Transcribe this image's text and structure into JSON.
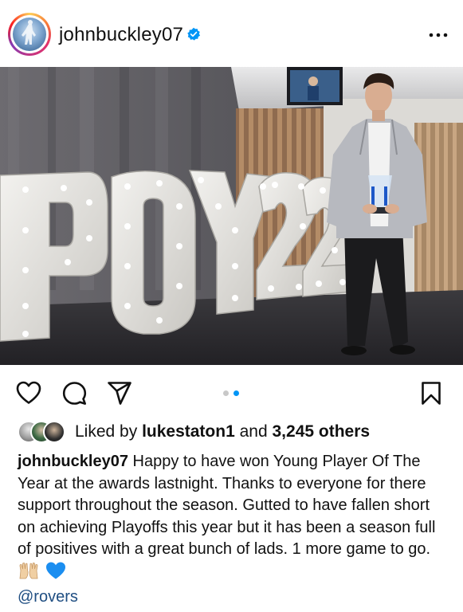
{
  "post": {
    "username": "johnbuckley07",
    "verified": true,
    "photo_sign": "POY22",
    "carousel": {
      "total": 2,
      "active": 2
    },
    "liked_by_prefix": "Liked by",
    "liked_by_user": "lukestaton1",
    "liked_by_middle": "and",
    "likes_others": "3,245 others",
    "caption_user": "johnbuckley07",
    "caption_text": "Happy to have won Young Player Of The Year at the awards lastnight. Thanks to everyone for there support throughout the season. Gutted to have fallen short on achieving Playoffs this year but it has been a season full of positives with a great bunch of lads. 1 more game to go.",
    "caption_emojis": [
      "raising-hands",
      "blue-heart"
    ],
    "mention": "@rovers"
  },
  "colors": {
    "verified_blue": "#0095f6",
    "dot_active": "#0095f6",
    "dot_inactive": "#c8c8c8",
    "mention": "#1f4e82"
  },
  "icons": [
    "heart-icon",
    "comment-icon",
    "share-icon",
    "bookmark-icon",
    "more-options-icon",
    "verified-badge-icon"
  ]
}
